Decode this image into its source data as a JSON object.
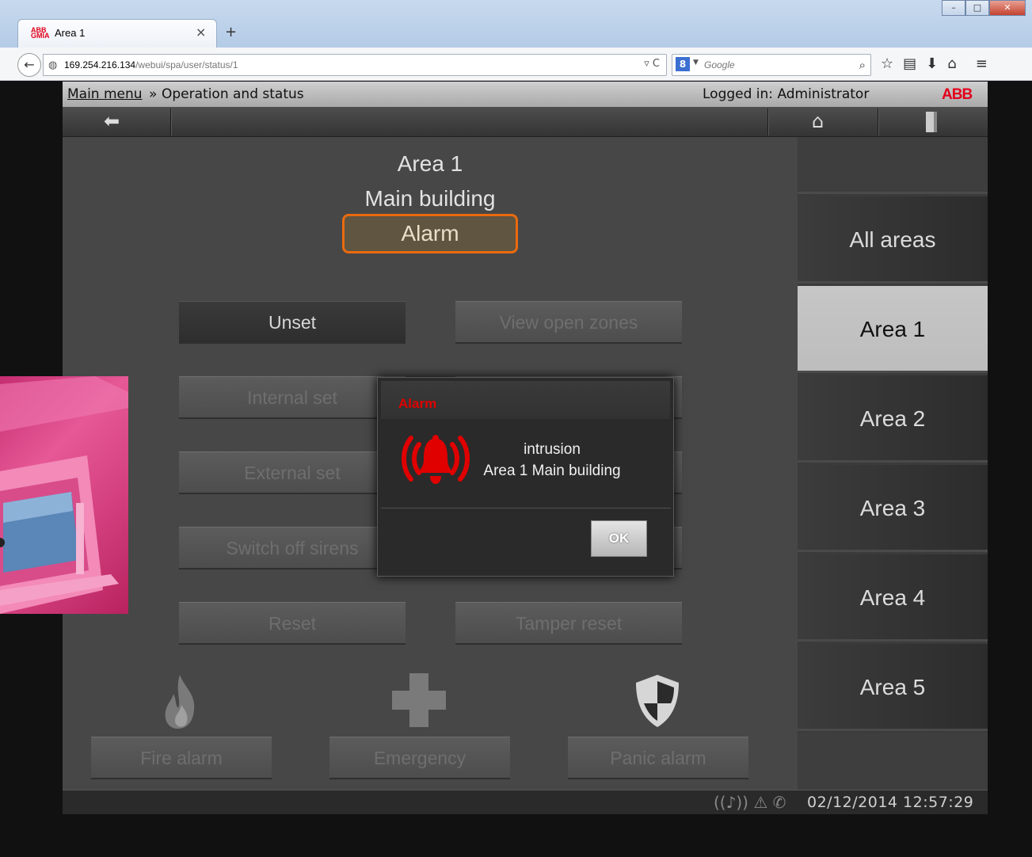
{
  "browser": {
    "tab_title": "Area 1",
    "tab_logo": "ABB GMIA",
    "url_host": "169.254.216.134",
    "url_path": "/webui/spa/user/status/1",
    "search_placeholder": "Google"
  },
  "header": {
    "breadcrumb_link": "Main menu",
    "breadcrumb_separator": "»",
    "breadcrumb_current": "Operation and status",
    "logged_in": "Logged in: Administrator",
    "logo": "ABB"
  },
  "status": {
    "area": "Area 1",
    "building": "Main building",
    "state": "Alarm",
    "state_border_color": "#ea6a0e"
  },
  "buttons": {
    "unset": "Unset",
    "view_open_zones": "View open zones",
    "internal_set": "Internal set",
    "external_set": "External set",
    "switch_off_sirens": "Switch off sirens",
    "reset": "Reset",
    "tamper_reset": "Tamper reset",
    "fire_alarm": "Fire alarm",
    "emergency": "Emergency",
    "panic_alarm": "Panic alarm"
  },
  "sidebar": {
    "items": [
      {
        "label": "All areas",
        "selected": false
      },
      {
        "label": "Area 1",
        "selected": true
      },
      {
        "label": "Area 2",
        "selected": false
      },
      {
        "label": "Area 3",
        "selected": false
      },
      {
        "label": "Area 4",
        "selected": false
      },
      {
        "label": "Area 5",
        "selected": false
      }
    ]
  },
  "statusbar": {
    "datetime": "02/12/2014 12:57:29"
  },
  "dialog": {
    "title": "Alarm",
    "message_line1": "intrusion",
    "message_line2": "Area 1 Main building",
    "ok_label": "OK",
    "title_color": "#e00000"
  }
}
